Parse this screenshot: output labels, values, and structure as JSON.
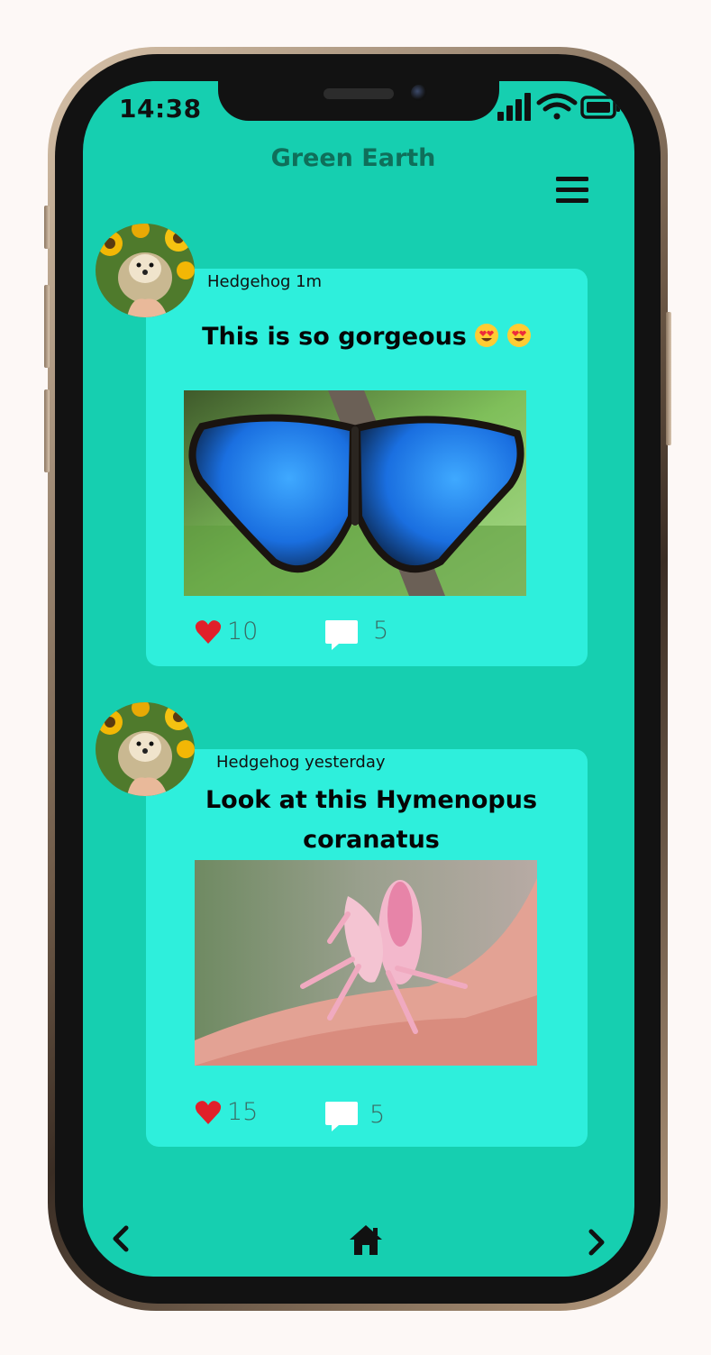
{
  "status_bar": {
    "time": "14:38",
    "icons": [
      "signal-icon",
      "wifi-icon",
      "battery-icon"
    ]
  },
  "header": {
    "title": "Green Earth",
    "menu_icon": "menu-icon"
  },
  "posts": [
    {
      "author": "Hedgehog",
      "time": "1m",
      "meta": "Hedgehog 1m",
      "title": "This is so gorgeous",
      "emojis": [
        "heart-eyes-emoji",
        "heart-eyes-emoji"
      ],
      "image": "blue-morpho-butterfly-image",
      "likes": "10",
      "comments": "5"
    },
    {
      "author": "Hedgehog",
      "time": "yesterday",
      "meta": "Hedgehog yesterday",
      "title_line1": "Look at this Hymenopus",
      "title_line2": "coranatus",
      "image": "orchid-mantis-image",
      "likes": "15",
      "comments": "5"
    }
  ],
  "bottom_nav": {
    "icons": [
      "chevron-left-icon",
      "home-icon",
      "chevron-right-icon"
    ]
  },
  "colors": {
    "screen_bg": "#16cfb0",
    "card_bg": "#2eefdc",
    "title_color": "#0f6f5a",
    "like_color": "#e0202a"
  }
}
